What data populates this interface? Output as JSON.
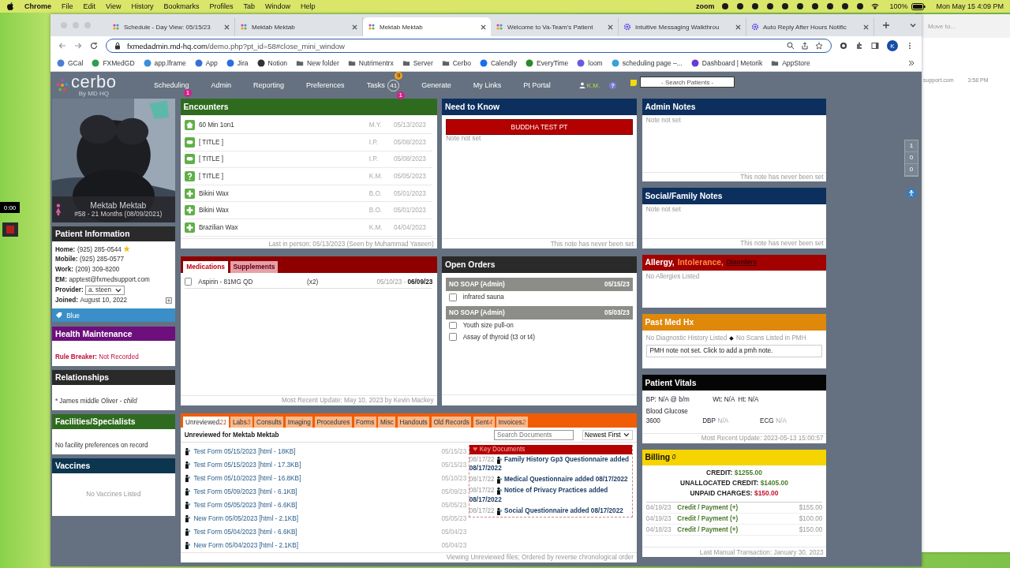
{
  "menubar": {
    "app": "Chrome",
    "menus": [
      "File",
      "Edit",
      "View",
      "History",
      "Bookmarks",
      "Profiles",
      "Tab",
      "Window",
      "Help"
    ],
    "zoom": "zoom",
    "battery": "100%",
    "clock": "Mon May 15  4:09 PM"
  },
  "desktop": {
    "timer": "0:00",
    "side_window": {
      "button": "Move to...",
      "site": "support.com",
      "time": "3:58 PM"
    }
  },
  "browser": {
    "tabs": [
      {
        "title": "Schedule - Day View: 05/15/23",
        "kind": "cerbo",
        "selected": false
      },
      {
        "title": "Mektab Mektab",
        "kind": "cerbo",
        "selected": false
      },
      {
        "title": "Mektab Mektab",
        "kind": "cerbo",
        "selected": true
      },
      {
        "title": "Welcome to Va-Team's Patient",
        "kind": "cerbo",
        "selected": false
      },
      {
        "title": "Intuitive Messaging Walkthrou",
        "kind": "gear",
        "selected": false
      },
      {
        "title": "Auto Reply After Hours Notific",
        "kind": "gear",
        "selected": false
      }
    ],
    "url_host": "fxmedadmin.md-hq.com",
    "url_path": "/demo.php?pt_id=58#close_mini_window",
    "profile": "K",
    "bookmarks": [
      {
        "label": "GCal",
        "kind": "site",
        "color": "#4a7fd4"
      },
      {
        "label": "FXMedGD",
        "kind": "site",
        "color": "#2e9e4f"
      },
      {
        "label": "app.lframe",
        "kind": "site",
        "color": "#3a8fd8"
      },
      {
        "label": "App",
        "kind": "site",
        "color": "#3a6fd8"
      },
      {
        "label": "Jira",
        "kind": "site",
        "color": "#2a6ee0"
      },
      {
        "label": "Notion",
        "kind": "site",
        "color": "#333333"
      },
      {
        "label": "New folder",
        "kind": "folder",
        "color": "#5f6368"
      },
      {
        "label": "Nutrimentrx",
        "kind": "folder",
        "color": "#5f6368"
      },
      {
        "label": "Server",
        "kind": "folder",
        "color": "#5f6368"
      },
      {
        "label": "Cerbo",
        "kind": "folder",
        "color": "#5f6368"
      },
      {
        "label": "Calendly",
        "kind": "site",
        "color": "#1a6ee8"
      },
      {
        "label": "EveryTime",
        "kind": "site",
        "color": "#2a8a2a"
      },
      {
        "label": "loom",
        "kind": "site",
        "color": "#6a5ae0"
      },
      {
        "label": "scheduling page –...",
        "kind": "site",
        "color": "#3aa0d8"
      },
      {
        "label": "Dashboard | Metorik",
        "kind": "site",
        "color": "#6a3ad8"
      },
      {
        "label": "AppStore",
        "kind": "folder",
        "color": "#5f6368"
      }
    ]
  },
  "app": {
    "logo": "cerbo",
    "logo_sub": "By MD HQ",
    "nav": [
      {
        "label": "Scheduling",
        "badge": "1"
      },
      {
        "label": "Admin"
      },
      {
        "label": "Reporting"
      },
      {
        "label": "Preferences"
      },
      {
        "label": "Tasks",
        "badge": "1",
        "count": "41",
        "alert": "9"
      },
      {
        "label": "Generate"
      },
      {
        "label": "My Links"
      },
      {
        "label": "Pt Portal"
      }
    ],
    "user": "K.M.",
    "help": "?",
    "search_placeholder": "- Search Patients -",
    "side_counters": [
      "1",
      "0",
      "0"
    ]
  },
  "patient": {
    "name": "Mektab Mektab",
    "subtitle": "#58 - 21 Months (08/09/2021)",
    "info_title": "Patient Information",
    "contacts": [
      {
        "label": "Home:",
        "value": "(925) 285-0544",
        "starred": true
      },
      {
        "label": "Mobile:",
        "value": "(925) 285-0577",
        "starred": false
      },
      {
        "label": "Work:",
        "value": "(209) 309-8200",
        "starred": false
      },
      {
        "label": "EM:",
        "value": "apptest@fxmedsupport.com",
        "starred": false
      }
    ],
    "provider_label": "Provider:",
    "provider": "a. steen",
    "joined_label": "Joined:",
    "joined": "August 10, 2022",
    "tag": "Blue"
  },
  "left_sections": [
    {
      "title": "Health Maintenance",
      "kind": "health",
      "label": "Rule Breaker:",
      "text": "Not Recorded"
    },
    {
      "title": "Relationships",
      "kind": "relations",
      "text": "* James middle Oliver - ",
      "emph": "child"
    },
    {
      "title": "Facilities/Specialists",
      "kind": "facilities",
      "text": "No facility preferences on record"
    },
    {
      "title": "Vaccines",
      "kind": "vaccines",
      "text": "No Vaccines Listed"
    }
  ],
  "encounters": {
    "title": "Encounters",
    "rows": [
      {
        "kind": "home",
        "title": "60 Min 1on1",
        "provider": "M.Y.",
        "date": "05/13/2023"
      },
      {
        "kind": "chat",
        "title": "[ TITLE ]",
        "provider": "I.P.",
        "date": "05/08/2023"
      },
      {
        "kind": "chat",
        "title": "[ TITLE ]",
        "provider": "I.P.",
        "date": "05/08/2023"
      },
      {
        "kind": "question",
        "title": "[ TITLE ]",
        "provider": "K.M.",
        "date": "05/05/2023"
      },
      {
        "kind": "plus",
        "title": "Bikini Wax",
        "provider": "B.O.",
        "date": "05/01/2023"
      },
      {
        "kind": "plus",
        "title": "Bikini Wax",
        "provider": "B.O.",
        "date": "05/01/2023"
      },
      {
        "kind": "plus",
        "title": "Brazilian Wax",
        "provider": "K.M.",
        "date": "04/04/2023"
      }
    ],
    "footer": "Last in person: 05/13/2023 (Seen by Muhammad Yaseen)"
  },
  "need_to_know": {
    "title": "Need to Know",
    "banner": "BUDDHA TEST PT",
    "note": "Note not set",
    "footer": "This note has never been set"
  },
  "admin_notes": {
    "title": "Admin Notes",
    "note": "Note not set",
    "footer": "This note has never been set"
  },
  "social_notes": {
    "title": "Social/Family Notes",
    "note": "Note not set",
    "footer": "This note has never been set"
  },
  "medications": {
    "tabs": [
      {
        "label": "Medications",
        "selected": true
      },
      {
        "label": "Supplements",
        "selected": false
      }
    ],
    "items": [
      {
        "name": "Aspirin - 81MG QD",
        "qty": "(x2)",
        "dates": "05/10/23 - **06/09/23**",
        "checked": false
      }
    ],
    "footer": "Most Recent Update: May 10, 2023 by Kevin Mackey"
  },
  "open_orders": {
    "title": "Open Orders",
    "groups": [
      {
        "title": "NO SOAP (Admin)",
        "date": "05/15/23",
        "items": [
          {
            "label": "infrared sauna",
            "checked": false
          }
        ]
      },
      {
        "title": "NO SOAP (Admin)",
        "date": "05/03/23",
        "items": [
          {
            "label": "Youth size pull-on",
            "checked": false
          },
          {
            "label": "Assay of thyroid (t3 or t4)",
            "checked": false
          }
        ]
      }
    ]
  },
  "allergy": {
    "titles": [
      "Allergy,",
      "Intolerance,",
      "Disorders"
    ],
    "text": "No Allergies Listed"
  },
  "past_med_hx": {
    "title": "Past Med Hx",
    "diag": "No Diagnostic History Listed",
    "scans": "No Scans Listed in PMH",
    "note": "PMH note not set. Click to add a pmh note."
  },
  "vitals": {
    "title": "Patient Vitals",
    "items": [
      {
        "label": "BP:",
        "value": "N/A @ b/m"
      },
      {
        "label": "Wt:",
        "value": "N/A"
      },
      {
        "label": "Ht:",
        "value": "N/A"
      }
    ],
    "readings": [
      {
        "label": "Blood Glucose",
        "value": "3600"
      },
      {
        "label": "DBP",
        "value": "N/A"
      },
      {
        "label": "ECG",
        "value": "N/A"
      }
    ],
    "footer": "Most Recent Update: 2023-05-13 15:00:57"
  },
  "billing": {
    "title": "Billing",
    "count": "0",
    "summary": [
      {
        "label": "CREDIT:",
        "value": "$1255.00",
        "color": "#4a7a2a"
      },
      {
        "label": "UNALLOCATED CREDIT:",
        "value": "$1405.00",
        "color": "#4a7a2a"
      },
      {
        "label": "UNPAID CHARGES:",
        "value": "$150.00",
        "color": "#c0102a"
      }
    ],
    "transactions": [
      {
        "date": "04/19/23",
        "label": "Credit / Payment (+)",
        "amount": "$155.00"
      },
      {
        "date": "04/19/23",
        "label": "Credit / Payment (+)",
        "amount": "$100.00"
      },
      {
        "date": "04/18/23",
        "label": "Credit / Payment (+)",
        "amount": "$150.00"
      }
    ],
    "footer": "Last Manual Transaction: January 30, 2023"
  },
  "documents": {
    "tabs": [
      {
        "label": "Unreviewed",
        "count": "21",
        "selected": true
      },
      {
        "label": "Labs",
        "count": "3",
        "selected": false
      },
      {
        "label": "Consults",
        "selected": false
      },
      {
        "label": "Imaging",
        "selected": false
      },
      {
        "label": "Procedures",
        "selected": false
      },
      {
        "label": "Forms",
        "selected": false
      },
      {
        "label": "Misc",
        "selected": false
      },
      {
        "label": "Handouts",
        "selected": false
      },
      {
        "label": "Old Records",
        "selected": false
      },
      {
        "label": "Sent",
        "count": "4",
        "selected": false
      },
      {
        "label": "Invoices",
        "count": "2",
        "selected": false
      }
    ],
    "heading": "Unreviewed for Mektab Mektab",
    "search_placeholder": "Search Documents",
    "sort": "Newest First",
    "files": [
      {
        "name": "Test Form 05/15/2023",
        "meta": "[html - 18KB]",
        "date": "05/15/23"
      },
      {
        "name": "Test Form 05/15/2023",
        "meta": "[html - 17.3KB]",
        "date": "05/15/23"
      },
      {
        "name": "Test Form 05/10/2023",
        "meta": "[html - 16.8KB]",
        "date": "05/10/23"
      },
      {
        "name": "Test Form 05/09/2023",
        "meta": "[html - 6.1KB]",
        "date": "05/09/23"
      },
      {
        "name": "Test Form 05/05/2023",
        "meta": "[html - 6.6KB]",
        "date": "05/05/23"
      },
      {
        "name": "New Form 05/05/2023",
        "meta": "[html - 2.1KB]",
        "date": "05/05/23"
      },
      {
        "name": "Test Form 05/04/2023",
        "meta": "[html - 6.6KB]",
        "date": "05/04/23"
      },
      {
        "name": "New Form 05/04/2023",
        "meta": "[html - 2.1KB]",
        "date": "05/04/23"
      }
    ],
    "key_title": "Key Documents",
    "key_docs": [
      {
        "date": "08/17/22",
        "title": "Family History Gp3 Questionnaire added 08/17/2022"
      },
      {
        "date": "08/17/22",
        "title": "Medical Questionnaire added 08/17/2022"
      },
      {
        "date": "08/17/22",
        "title": "Notice of Privacy Practices added 08/17/2022"
      },
      {
        "date": "08/17/22",
        "title": "Social Questionnaire added 08/17/2022"
      }
    ],
    "footer": "Viewing Unreviewed files; Ordered by reverse chronological order"
  }
}
